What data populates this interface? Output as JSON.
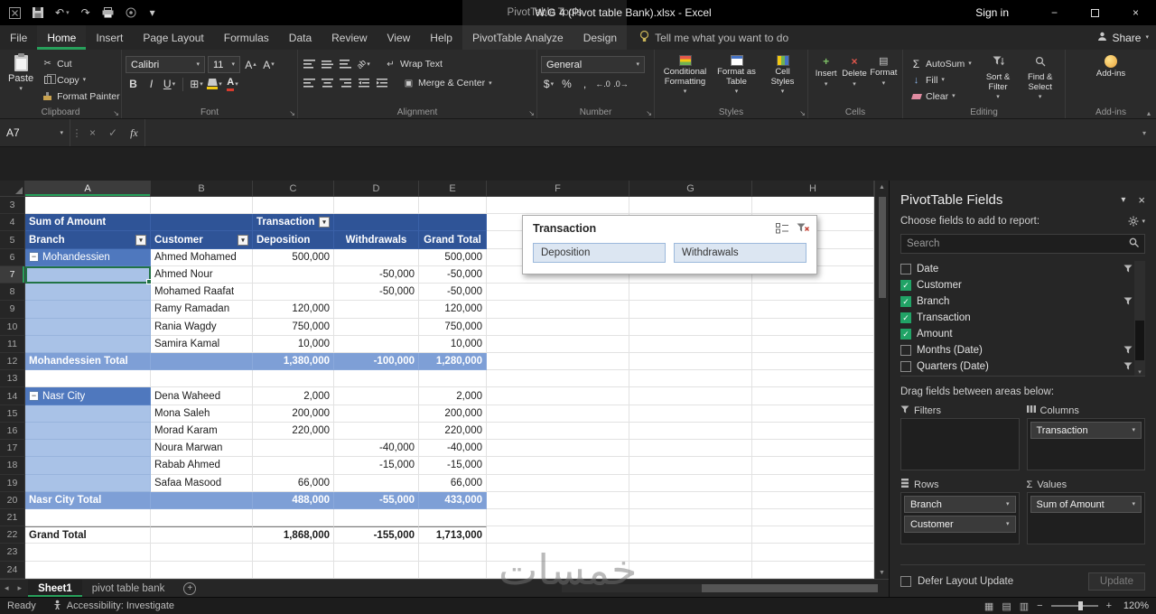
{
  "titlebar": {
    "contextual_title": "PivotTable Tools",
    "title": "W.G 4 (Pivot table Bank).xlsx - Excel",
    "sign_in": "Sign in"
  },
  "ribbon": {
    "tabs": [
      "File",
      "Home",
      "Insert",
      "Page Layout",
      "Formulas",
      "Data",
      "Review",
      "View",
      "Help",
      "PivotTable Analyze",
      "Design"
    ],
    "active_tab": "Home",
    "contextual_tabs": [
      "PivotTable Analyze",
      "Design"
    ],
    "tell_me": "Tell me what you want to do",
    "share": "Share",
    "groups": {
      "clipboard": {
        "label": "Clipboard",
        "paste": "Paste",
        "cut": "Cut",
        "copy": "Copy",
        "format_painter": "Format Painter"
      },
      "font": {
        "label": "Font",
        "font_name": "Calibri",
        "font_size": "11",
        "bold": "B",
        "italic": "I",
        "underline": "U"
      },
      "alignment": {
        "label": "Alignment",
        "wrap_text": "Wrap Text",
        "merge_center": "Merge & Center"
      },
      "number": {
        "label": "Number",
        "format": "General"
      },
      "styles": {
        "label": "Styles",
        "conditional_formatting": "Conditional Formatting",
        "format_as_table": "Format as Table",
        "cell_styles": "Cell Styles"
      },
      "cells": {
        "label": "Cells",
        "insert": "Insert",
        "delete": "Delete",
        "format": "Format"
      },
      "editing": {
        "label": "Editing",
        "autosum": "AutoSum",
        "fill": "Fill",
        "clear": "Clear",
        "sort_filter": "Sort & Filter",
        "find_select": "Find & Select"
      },
      "addins": {
        "label": "Add-ins",
        "button": "Add-ins"
      }
    }
  },
  "formula_bar": {
    "name_box": "A7",
    "fx_label": "fx"
  },
  "grid": {
    "columns": [
      "A",
      "B",
      "C",
      "D",
      "E",
      "F",
      "G",
      "H"
    ],
    "selected_cell": {
      "column": "A",
      "row": "7"
    },
    "rows": [
      {
        "n": "3",
        "type": "blank",
        "cells": {}
      },
      {
        "n": "4",
        "type": "h1",
        "cells": {
          "A": "Sum of Amount",
          "C": "Transaction"
        }
      },
      {
        "n": "5",
        "type": "h2",
        "cells": {
          "A": "Branch",
          "B": "Customer",
          "C": "Deposition",
          "D": "Withdrawals",
          "E": "Grand Total"
        }
      },
      {
        "n": "6",
        "type": "gfirst",
        "cells": {
          "A": "Mohandessien",
          "B": "Ahmed Mohamed",
          "C": "500,000",
          "E": "500,000"
        }
      },
      {
        "n": "7",
        "type": "g",
        "cells": {
          "B": "Ahmed Nour",
          "D": "-50,000",
          "E": "-50,000"
        }
      },
      {
        "n": "8",
        "type": "g",
        "cells": {
          "B": "Mohamed Raafat",
          "D": "-50,000",
          "E": "-50,000"
        }
      },
      {
        "n": "9",
        "type": "g",
        "cells": {
          "B": "Ramy Ramadan",
          "C": "120,000",
          "E": "120,000"
        }
      },
      {
        "n": "10",
        "type": "g",
        "cells": {
          "B": "Rania Wagdy",
          "C": "750,000",
          "E": "750,000"
        }
      },
      {
        "n": "11",
        "type": "g",
        "cells": {
          "B": "Samira Kamal",
          "C": "10,000",
          "E": "10,000"
        }
      },
      {
        "n": "12",
        "type": "total",
        "cells": {
          "A": "Mohandessien Total",
          "C": "1,380,000",
          "D": "-100,000",
          "E": "1,280,000"
        }
      },
      {
        "n": "13",
        "type": "blank",
        "cells": {}
      },
      {
        "n": "14",
        "type": "gfirst",
        "cells": {
          "A": "Nasr City",
          "B": "Dena Waheed",
          "C": "2,000",
          "E": "2,000"
        }
      },
      {
        "n": "15",
        "type": "g",
        "cells": {
          "B": "Mona Saleh",
          "C": "200,000",
          "E": "200,000"
        }
      },
      {
        "n": "16",
        "type": "g",
        "cells": {
          "B": "Morad Karam",
          "C": "220,000",
          "E": "220,000"
        }
      },
      {
        "n": "17",
        "type": "g",
        "cells": {
          "B": "Noura Marwan",
          "D": "-40,000",
          "E": "-40,000"
        }
      },
      {
        "n": "18",
        "type": "g",
        "cells": {
          "B": "Rabab Ahmed",
          "D": "-15,000",
          "E": "-15,000"
        }
      },
      {
        "n": "19",
        "type": "g",
        "cells": {
          "B": "Safaa Masood",
          "C": "66,000",
          "E": "66,000"
        }
      },
      {
        "n": "20",
        "type": "total",
        "cells": {
          "A": "Nasr City Total",
          "C": "488,000",
          "D": "-55,000",
          "E": "433,000"
        }
      },
      {
        "n": "21",
        "type": "blank",
        "cells": {}
      },
      {
        "n": "22",
        "type": "grand",
        "cells": {
          "A": "Grand Total",
          "C": "1,868,000",
          "D": "-155,000",
          "E": "1,713,000"
        }
      },
      {
        "n": "23",
        "type": "blank",
        "cells": {}
      },
      {
        "n": "24",
        "type": "blank",
        "cells": {}
      }
    ]
  },
  "slicer": {
    "title": "Transaction",
    "buttons": [
      "Deposition",
      "Withdrawals"
    ]
  },
  "fields_pane": {
    "title": "PivotTable Fields",
    "subtitle": "Choose fields to add to report:",
    "search_placeholder": "Search",
    "fields": [
      {
        "name": "Date",
        "checked": false,
        "filter": true
      },
      {
        "name": "Customer",
        "checked": true,
        "filter": false
      },
      {
        "name": "Branch",
        "checked": true,
        "filter": true
      },
      {
        "name": "Transaction",
        "checked": true,
        "filter": false
      },
      {
        "name": "Amount",
        "checked": true,
        "filter": false
      },
      {
        "name": "Months (Date)",
        "checked": false,
        "filter": true
      },
      {
        "name": "Quarters (Date)",
        "checked": false,
        "filter": true
      }
    ],
    "drag_hint": "Drag fields between areas below:",
    "areas": [
      {
        "label": "Filters",
        "icon": "filter",
        "items": []
      },
      {
        "label": "Columns",
        "icon": "columns",
        "items": [
          "Transaction"
        ]
      },
      {
        "label": "Rows",
        "icon": "rows",
        "items": [
          "Branch",
          "Customer"
        ]
      },
      {
        "label": "Values",
        "icon": "sigma",
        "items": [
          "Sum of Amount"
        ]
      }
    ],
    "defer_label": "Defer Layout Update",
    "update_label": "Update"
  },
  "sheet_tabs": {
    "tabs": [
      {
        "label": "Sheet1",
        "active": true
      },
      {
        "label": "pivot table bank",
        "active": false
      }
    ]
  },
  "status_bar": {
    "mode": "Ready",
    "accessibility": "Accessibility: Investigate",
    "zoom": "120%"
  },
  "watermark": "خمسات",
  "colors": {
    "accent_green": "#27A05B",
    "pivot_header_blue": "#2F5497",
    "pivot_group_blue": "#4F78BE",
    "pivot_light_blue": "#A9C2E7",
    "pivot_total_blue": "#7E9FD6",
    "slicer_button_blue": "#DCE6F2"
  }
}
